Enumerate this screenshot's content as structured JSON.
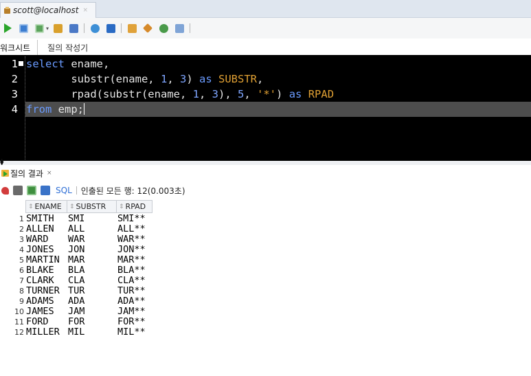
{
  "connection_tab": {
    "title": "scott@localhost",
    "close": "×"
  },
  "toolbar": {
    "buttons": [
      "run-statement",
      "run-script",
      "explain-plan",
      "autotrace",
      "commit",
      "rollback",
      "unshared-sql",
      "clear",
      "sql-history",
      "format"
    ]
  },
  "editor_tabs": {
    "worksheet": "워크시트",
    "query_builder": "질의 작성기"
  },
  "editor": {
    "line_numbers": [
      "1",
      "2",
      "3",
      "4"
    ],
    "lines": [
      [
        {
          "t": "select",
          "c": "kw"
        },
        {
          "t": " ename,",
          "c": ""
        }
      ],
      [
        {
          "t": "       substr(ename, ",
          "c": ""
        },
        {
          "t": "1",
          "c": "num"
        },
        {
          "t": ", ",
          "c": ""
        },
        {
          "t": "3",
          "c": "num"
        },
        {
          "t": ") ",
          "c": ""
        },
        {
          "t": "as",
          "c": "kw"
        },
        {
          "t": " ",
          "c": ""
        },
        {
          "t": "SUBSTR",
          "c": "alias"
        },
        {
          "t": ",",
          "c": ""
        }
      ],
      [
        {
          "t": "       rpad(substr(ename, ",
          "c": ""
        },
        {
          "t": "1",
          "c": "num"
        },
        {
          "t": ", ",
          "c": ""
        },
        {
          "t": "3",
          "c": "num"
        },
        {
          "t": "), ",
          "c": ""
        },
        {
          "t": "5",
          "c": "num"
        },
        {
          "t": ", ",
          "c": ""
        },
        {
          "t": "'*'",
          "c": "str"
        },
        {
          "t": ") ",
          "c": ""
        },
        {
          "t": "as",
          "c": "kw"
        },
        {
          "t": " ",
          "c": ""
        },
        {
          "t": "RPAD",
          "c": "alias"
        }
      ],
      [
        {
          "t": "from",
          "c": "kw"
        },
        {
          "t": " emp;",
          "c": ""
        }
      ]
    ]
  },
  "results": {
    "tab_label": "질의 결과",
    "tab_close": "×",
    "sql_link": "SQL",
    "fetch_status": "인출된 모든 행: 12(0.003초)",
    "columns": [
      "ENAME",
      "SUBSTR",
      "RPAD"
    ],
    "rows": [
      [
        "1",
        "SMITH",
        "SMI",
        "SMI**"
      ],
      [
        "2",
        "ALLEN",
        "ALL",
        "ALL**"
      ],
      [
        "3",
        "WARD",
        "WAR",
        "WAR**"
      ],
      [
        "4",
        "JONES",
        "JON",
        "JON**"
      ],
      [
        "5",
        "MARTIN",
        "MAR",
        "MAR**"
      ],
      [
        "6",
        "BLAKE",
        "BLA",
        "BLA**"
      ],
      [
        "7",
        "CLARK",
        "CLA",
        "CLA**"
      ],
      [
        "8",
        "TURNER",
        "TUR",
        "TUR**"
      ],
      [
        "9",
        "ADAMS",
        "ADA",
        "ADA**"
      ],
      [
        "10",
        "JAMES",
        "JAM",
        "JAM**"
      ],
      [
        "11",
        "FORD",
        "FOR",
        "FOR**"
      ],
      [
        "12",
        "MILLER",
        "MIL",
        "MIL**"
      ]
    ]
  },
  "colors": {
    "keyword": "#6a9bff",
    "alias": "#e0a033",
    "editor_bg": "#000000",
    "current_line": "#4d4d4d",
    "link": "#2f6fd6"
  }
}
